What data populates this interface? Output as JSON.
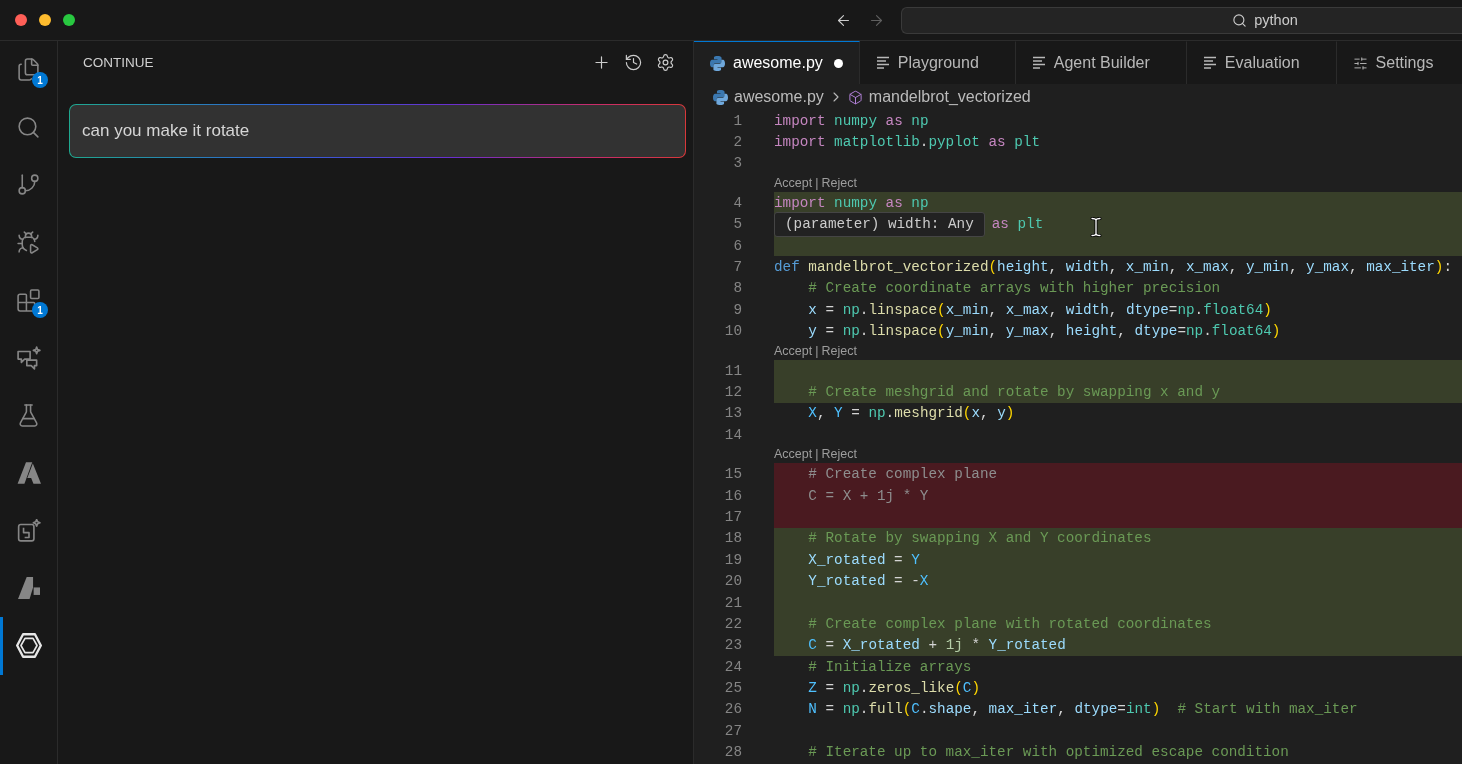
{
  "title_bar": {
    "window_controls": [
      {
        "kind": "close"
      },
      {
        "kind": "minimize"
      },
      {
        "kind": "maximize"
      }
    ],
    "navigation": [
      {
        "kind": "back",
        "disabled": false
      },
      {
        "kind": "forward",
        "disabled": true
      }
    ],
    "command_center": {
      "label": "python"
    }
  },
  "activity_bar": {
    "items": [
      {
        "kind": "files",
        "badge": "1",
        "selected": false
      },
      {
        "kind": "search",
        "selected": false
      },
      {
        "kind": "source_control",
        "selected": false
      },
      {
        "kind": "run_debug",
        "selected": false
      },
      {
        "kind": "extensions",
        "badge": "1",
        "selected": false
      },
      {
        "kind": "chat",
        "selected": false
      },
      {
        "kind": "testing",
        "selected": false
      },
      {
        "kind": "a_logo",
        "selected": false
      },
      {
        "kind": "sparkle_box",
        "selected": false
      },
      {
        "kind": "slanted_logo",
        "selected": false
      },
      {
        "kind": "hexagon_logo",
        "selected": true
      }
    ]
  },
  "sidebar": {
    "title": "CONTINUE",
    "actions": [
      {
        "kind": "add"
      },
      {
        "kind": "history"
      },
      {
        "kind": "settings"
      }
    ],
    "chat_input": {
      "value": "can you make it rotate"
    }
  },
  "editor": {
    "tabs": [
      {
        "kind": "python",
        "label": "awesome.py",
        "selected": true,
        "modified": true
      },
      {
        "kind": "text",
        "label": "Playground",
        "selected": false,
        "modified": false
      },
      {
        "kind": "text",
        "label": "Agent Builder",
        "selected": false,
        "modified": false
      },
      {
        "kind": "text",
        "label": "Evaluation",
        "selected": false,
        "modified": false
      },
      {
        "kind": "settings",
        "label": "Settings",
        "selected": false,
        "modified": false
      }
    ],
    "breadcrumbs": [
      {
        "kind": "file",
        "label": "awesome.py"
      },
      {
        "kind": "symbol",
        "label": "mandelbrot_vectorized"
      }
    ],
    "rows": [
      {
        "kind": "line",
        "number": "1",
        "indented": false,
        "tokens": [
          {
            "kind": "keyword",
            "text": "import "
          },
          {
            "kind": "module",
            "text": "numpy "
          },
          {
            "kind": "keyword",
            "text": "as "
          },
          {
            "kind": "module",
            "text": "np"
          }
        ]
      },
      {
        "kind": "line",
        "number": "2",
        "indented": false,
        "tokens": [
          {
            "kind": "keyword",
            "text": "import "
          },
          {
            "kind": "module",
            "text": "matplotlib"
          },
          {
            "kind": "plain",
            "text": "."
          },
          {
            "kind": "module",
            "text": "pyplot "
          },
          {
            "kind": "keyword",
            "text": "as "
          },
          {
            "kind": "module",
            "text": "plt"
          }
        ]
      },
      {
        "kind": "line",
        "number": "3"
      },
      {
        "kind": "codelens",
        "actions": [
          "Accept",
          "Reject"
        ],
        "separator": "|"
      },
      {
        "kind": "added_line",
        "number": "4",
        "indented": false,
        "tokens": [
          {
            "kind": "keyword",
            "text": "import "
          },
          {
            "kind": "module",
            "text": "numpy "
          },
          {
            "kind": "keyword",
            "text": "as "
          },
          {
            "kind": "module",
            "text": "np"
          }
        ]
      },
      {
        "kind": "added_line",
        "number": "5",
        "tooltip": "(parameter) width: Any",
        "indented": false,
        "tokens": [
          {
            "kind": "keyword",
            "text": "as "
          },
          {
            "kind": "module",
            "text": "plt"
          }
        ]
      },
      {
        "kind": "added_line",
        "number": "6"
      },
      {
        "kind": "line",
        "number": "7",
        "indented": false,
        "tokens": [
          {
            "kind": "storage",
            "text": "def "
          },
          {
            "kind": "function",
            "text": "mandelbrot_vectorized"
          },
          {
            "kind": "bracket",
            "text": "("
          },
          {
            "kind": "variable",
            "text": "height"
          },
          {
            "kind": "plain",
            "text": ", "
          },
          {
            "kind": "variable",
            "text": "width"
          },
          {
            "kind": "plain",
            "text": ", "
          },
          {
            "kind": "variable",
            "text": "x_min"
          },
          {
            "kind": "plain",
            "text": ", "
          },
          {
            "kind": "variable",
            "text": "x_max"
          },
          {
            "kind": "plain",
            "text": ", "
          },
          {
            "kind": "variable",
            "text": "y_min"
          },
          {
            "kind": "plain",
            "text": ", "
          },
          {
            "kind": "variable",
            "text": "y_max"
          },
          {
            "kind": "plain",
            "text": ", "
          },
          {
            "kind": "variable",
            "text": "max_iter"
          },
          {
            "kind": "bracket",
            "text": ")"
          },
          {
            "kind": "plain",
            "text": ":"
          }
        ]
      },
      {
        "kind": "line",
        "number": "8",
        "indented": true,
        "tokens": [
          {
            "kind": "comment",
            "text": "# Create coordinate arrays with higher precision"
          }
        ]
      },
      {
        "kind": "line",
        "number": "9",
        "indented": true,
        "tokens": [
          {
            "kind": "variable",
            "text": "x"
          },
          {
            "kind": "plain",
            "text": " = "
          },
          {
            "kind": "module",
            "text": "np"
          },
          {
            "kind": "plain",
            "text": "."
          },
          {
            "kind": "function",
            "text": "linspace"
          },
          {
            "kind": "bracket",
            "text": "("
          },
          {
            "kind": "variable",
            "text": "x_min"
          },
          {
            "kind": "plain",
            "text": ", "
          },
          {
            "kind": "variable",
            "text": "x_max"
          },
          {
            "kind": "plain",
            "text": ", "
          },
          {
            "kind": "variable",
            "text": "width"
          },
          {
            "kind": "plain",
            "text": ", "
          },
          {
            "kind": "variable",
            "text": "dtype"
          },
          {
            "kind": "plain",
            "text": "="
          },
          {
            "kind": "module",
            "text": "np"
          },
          {
            "kind": "plain",
            "text": "."
          },
          {
            "kind": "class",
            "text": "float64"
          },
          {
            "kind": "bracket",
            "text": ")"
          }
        ]
      },
      {
        "kind": "line",
        "number": "10",
        "indented": true,
        "tokens": [
          {
            "kind": "variable",
            "text": "y"
          },
          {
            "kind": "plain",
            "text": " = "
          },
          {
            "kind": "module",
            "text": "np"
          },
          {
            "kind": "plain",
            "text": "."
          },
          {
            "kind": "function",
            "text": "linspace"
          },
          {
            "kind": "bracket",
            "text": "("
          },
          {
            "kind": "variable",
            "text": "y_min"
          },
          {
            "kind": "plain",
            "text": ", "
          },
          {
            "kind": "variable",
            "text": "y_max"
          },
          {
            "kind": "plain",
            "text": ", "
          },
          {
            "kind": "variable",
            "text": "height"
          },
          {
            "kind": "plain",
            "text": ", "
          },
          {
            "kind": "variable",
            "text": "dtype"
          },
          {
            "kind": "plain",
            "text": "="
          },
          {
            "kind": "module",
            "text": "np"
          },
          {
            "kind": "plain",
            "text": "."
          },
          {
            "kind": "class",
            "text": "float64"
          },
          {
            "kind": "bracket",
            "text": ")"
          }
        ]
      },
      {
        "kind": "codelens",
        "actions": [
          "Accept",
          "Reject"
        ],
        "separator": "|"
      },
      {
        "kind": "added_line",
        "number": "11"
      },
      {
        "kind": "added_line",
        "number": "12",
        "indented": true,
        "tokens": [
          {
            "kind": "comment",
            "text": "# Create meshgrid and rotate by swapping x and y"
          }
        ]
      },
      {
        "kind": "line",
        "number": "13",
        "indented": true,
        "tokens": [
          {
            "kind": "constant",
            "text": "X"
          },
          {
            "kind": "plain",
            "text": ", "
          },
          {
            "kind": "constant",
            "text": "Y"
          },
          {
            "kind": "plain",
            "text": " = "
          },
          {
            "kind": "module",
            "text": "np"
          },
          {
            "kind": "plain",
            "text": "."
          },
          {
            "kind": "function",
            "text": "meshgrid"
          },
          {
            "kind": "bracket",
            "text": "("
          },
          {
            "kind": "variable",
            "text": "x"
          },
          {
            "kind": "plain",
            "text": ", "
          },
          {
            "kind": "variable",
            "text": "y"
          },
          {
            "kind": "bracket",
            "text": ")"
          }
        ]
      },
      {
        "kind": "line",
        "number": "14"
      },
      {
        "kind": "codelens",
        "actions": [
          "Accept",
          "Reject"
        ],
        "separator": "|"
      },
      {
        "kind": "removed_line",
        "number": "15",
        "indented": true,
        "text": "# Create complex plane"
      },
      {
        "kind": "removed_line",
        "number": "16",
        "indented": true,
        "text": "C = X + 1j * Y"
      },
      {
        "kind": "removed_line",
        "number": "17"
      },
      {
        "kind": "added_line",
        "number": "18",
        "indented": true,
        "tokens": [
          {
            "kind": "comment",
            "text": "# Rotate by swapping X and Y coordinates"
          }
        ]
      },
      {
        "kind": "added_line",
        "number": "19",
        "indented": true,
        "tokens": [
          {
            "kind": "variable",
            "text": "X_rotated"
          },
          {
            "kind": "plain",
            "text": " = "
          },
          {
            "kind": "constant",
            "text": "Y"
          }
        ]
      },
      {
        "kind": "added_line",
        "number": "20",
        "indented": true,
        "tokens": [
          {
            "kind": "variable",
            "text": "Y_rotated"
          },
          {
            "kind": "plain",
            "text": " = -"
          },
          {
            "kind": "constant",
            "text": "X"
          }
        ]
      },
      {
        "kind": "added_line",
        "number": "21"
      },
      {
        "kind": "added_line",
        "number": "22",
        "indented": true,
        "tokens": [
          {
            "kind": "comment",
            "text": "# Create complex plane with rotated coordinates"
          }
        ]
      },
      {
        "kind": "added_line",
        "number": "23",
        "indented": true,
        "tokens": [
          {
            "kind": "constant",
            "text": "C"
          },
          {
            "kind": "plain",
            "text": " = "
          },
          {
            "kind": "variable",
            "text": "X_rotated"
          },
          {
            "kind": "plain",
            "text": " + "
          },
          {
            "kind": "number",
            "text": "1j"
          },
          {
            "kind": "plain",
            "text": " * "
          },
          {
            "kind": "variable",
            "text": "Y_rotated"
          }
        ]
      },
      {
        "kind": "line",
        "number": "24",
        "indented": true,
        "tokens": [
          {
            "kind": "comment",
            "text": "# Initialize arrays"
          }
        ]
      },
      {
        "kind": "line",
        "number": "25",
        "indented": true,
        "tokens": [
          {
            "kind": "constant",
            "text": "Z"
          },
          {
            "kind": "plain",
            "text": " = "
          },
          {
            "kind": "module",
            "text": "np"
          },
          {
            "kind": "plain",
            "text": "."
          },
          {
            "kind": "function",
            "text": "zeros_like"
          },
          {
            "kind": "bracket",
            "text": "("
          },
          {
            "kind": "constant",
            "text": "C"
          },
          {
            "kind": "bracket",
            "text": ")"
          }
        ]
      },
      {
        "kind": "line",
        "number": "26",
        "indented": true,
        "tokens": [
          {
            "kind": "constant",
            "text": "N"
          },
          {
            "kind": "plain",
            "text": " = "
          },
          {
            "kind": "module",
            "text": "np"
          },
          {
            "kind": "plain",
            "text": "."
          },
          {
            "kind": "function",
            "text": "full"
          },
          {
            "kind": "bracket",
            "text": "("
          },
          {
            "kind": "constant",
            "text": "C"
          },
          {
            "kind": "plain",
            "text": "."
          },
          {
            "kind": "variable",
            "text": "shape"
          },
          {
            "kind": "plain",
            "text": ", "
          },
          {
            "kind": "variable",
            "text": "max_iter"
          },
          {
            "kind": "plain",
            "text": ", "
          },
          {
            "kind": "variable",
            "text": "dtype"
          },
          {
            "kind": "plain",
            "text": "="
          },
          {
            "kind": "class",
            "text": "int"
          },
          {
            "kind": "bracket",
            "text": ")"
          },
          {
            "kind": "comment",
            "text": "  # Start with max_iter"
          }
        ]
      },
      {
        "kind": "line",
        "number": "27"
      },
      {
        "kind": "line",
        "number": "28",
        "indented": true,
        "tokens": [
          {
            "kind": "comment",
            "text": "# Iterate up to max_iter with optimized escape condition"
          }
        ]
      }
    ]
  }
}
